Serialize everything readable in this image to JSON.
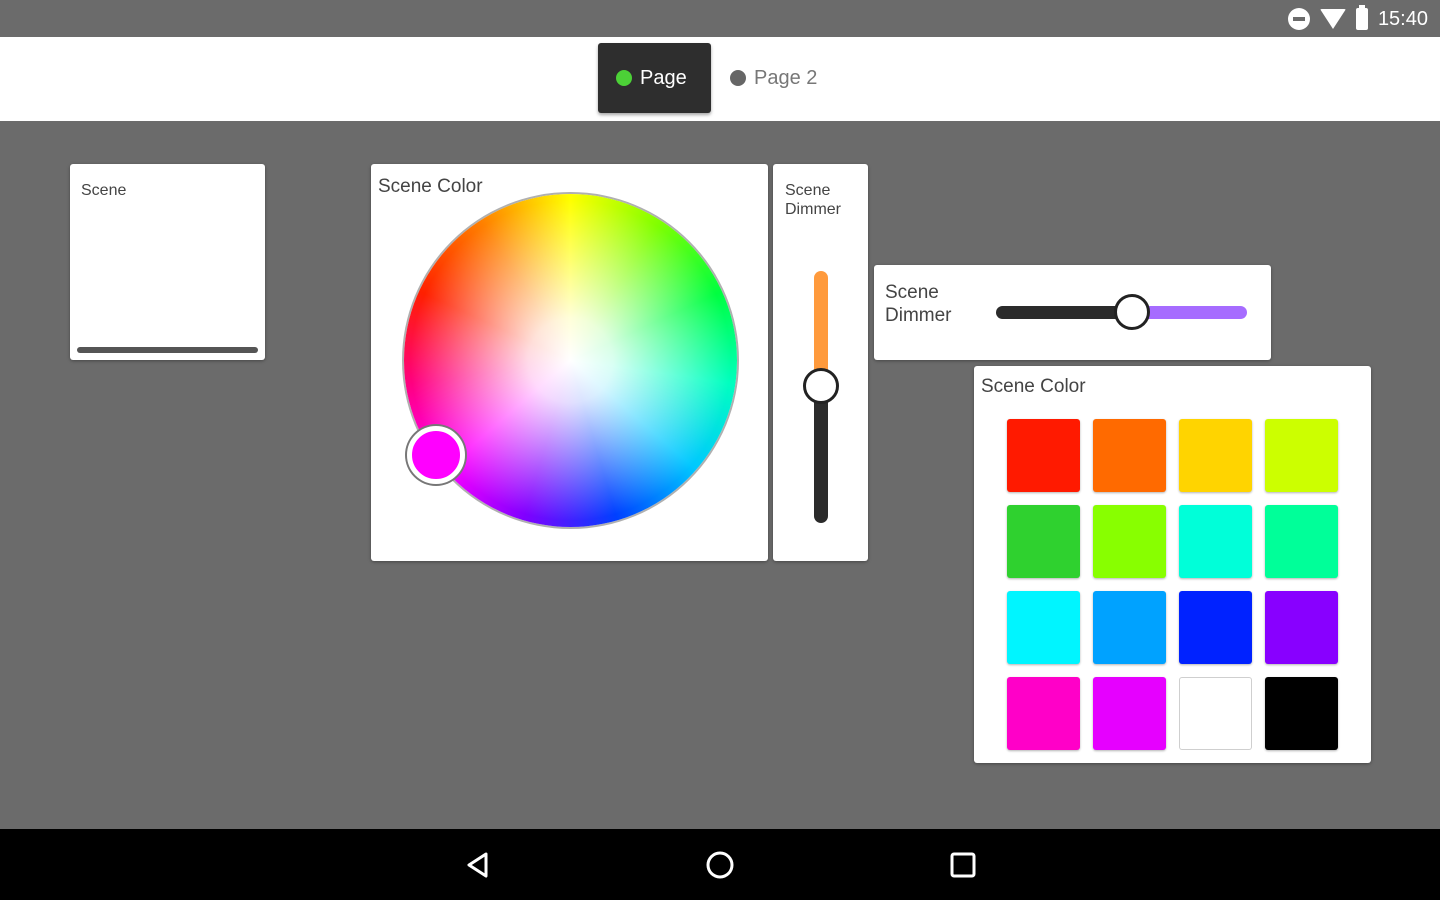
{
  "status_bar": {
    "time": "15:40",
    "icons": [
      "do-not-disturb-icon",
      "wifi-icon",
      "battery-icon"
    ]
  },
  "tabs": [
    {
      "label": "Page",
      "active": true,
      "dot_color": "#4cd137"
    },
    {
      "label": "Page 2",
      "active": false,
      "dot_color": "#666666"
    }
  ],
  "scene_widget": {
    "title": "Scene"
  },
  "color_wheel_widget": {
    "title": "Scene Color",
    "selected_color": "#ff00ff"
  },
  "vertical_dimmer": {
    "title": "Scene Dimmer",
    "active_color": "#ff9a3c"
  },
  "horizontal_dimmer": {
    "title": "Scene Dimmer",
    "active_color": "#a66cff"
  },
  "color_swatches": {
    "title": "Scene Color",
    "colors": [
      "#ff1a00",
      "#ff6a00",
      "#ffd400",
      "#ccff00",
      "#2fd12f",
      "#88ff00",
      "#00ffd9",
      "#00ff99",
      "#00f5ff",
      "#00a2ff",
      "#0022ff",
      "#8800ff",
      "#ff00c8",
      "#e600ff",
      "#ffffff",
      "#000000"
    ]
  },
  "nav_bar": {
    "buttons": [
      "back-icon",
      "home-icon",
      "recent-apps-icon"
    ]
  }
}
